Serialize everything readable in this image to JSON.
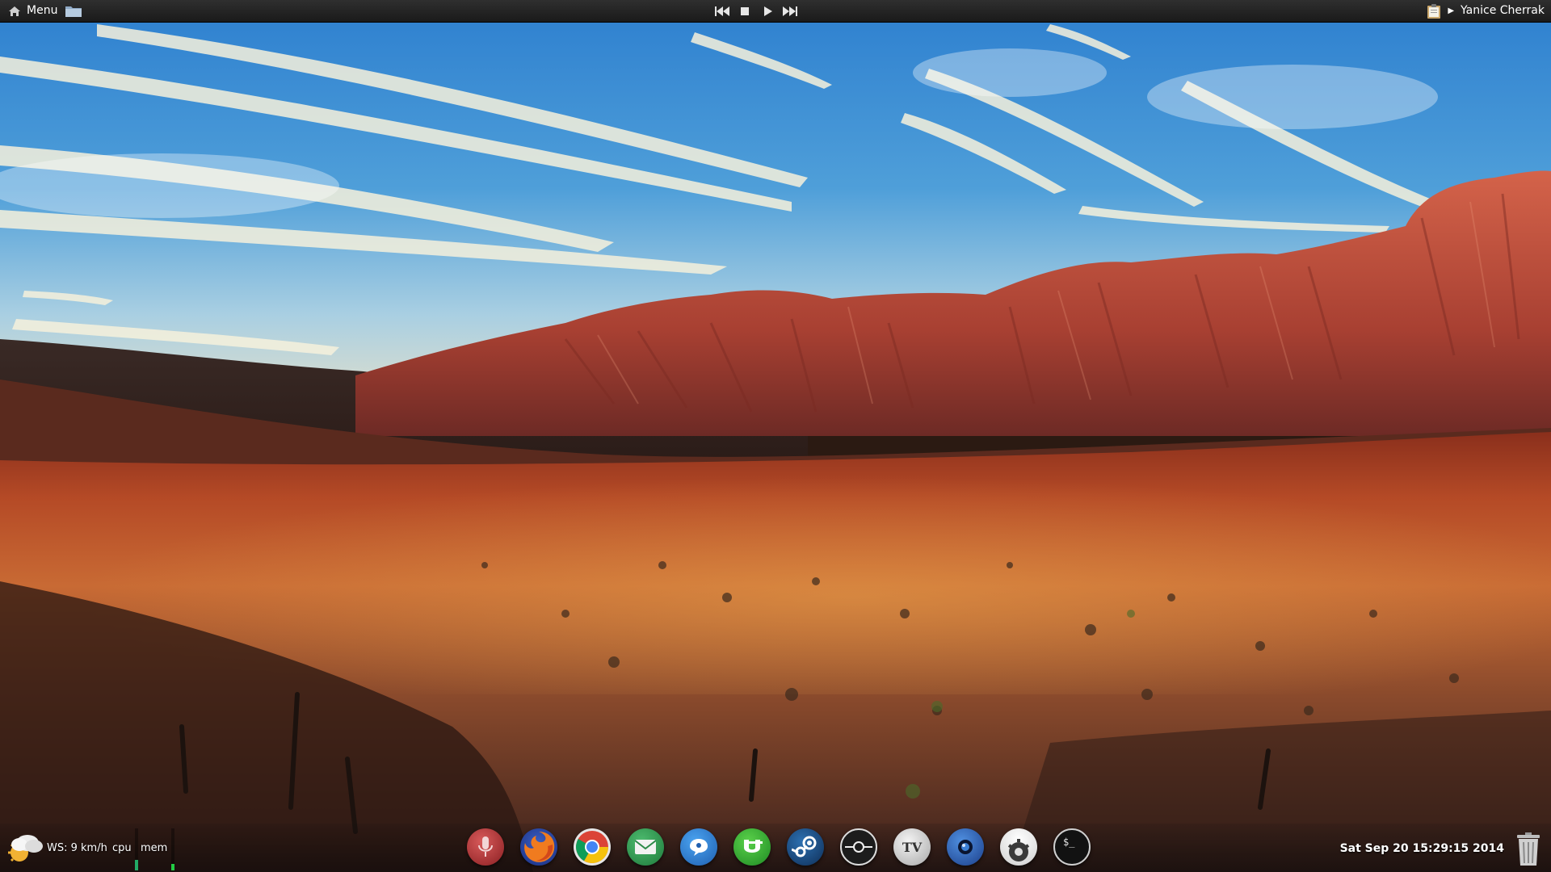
{
  "top_panel": {
    "menu_label": "Menu",
    "user_name": "Yanice Cherrak",
    "media_controls": [
      "previous-icon",
      "stop-icon",
      "play-icon",
      "next-icon"
    ]
  },
  "bottom_bar": {
    "wind_text": "WS: 9 km/h",
    "cpu_label": "cpu",
    "mem_label": "mem",
    "clock": "Sat Sep 20 15:29:15 2014",
    "cpu_level": 0.25,
    "mem_level": 0.15
  },
  "dock": {
    "items": [
      "audio-recorder-icon",
      "firefox-icon",
      "chrome-icon",
      "mail-icon",
      "chat-icon",
      "utorrent-icon",
      "steam-icon",
      "disk-icon",
      "tv-icon",
      "camera-icon",
      "cloud-gear-icon",
      "terminal-icon"
    ],
    "tv_label": "TV",
    "terminal_label": "$_"
  },
  "colors": {
    "panel_bg": "#1e1e1e",
    "sky": "#3d8ad0",
    "rock": "#c2553a"
  }
}
